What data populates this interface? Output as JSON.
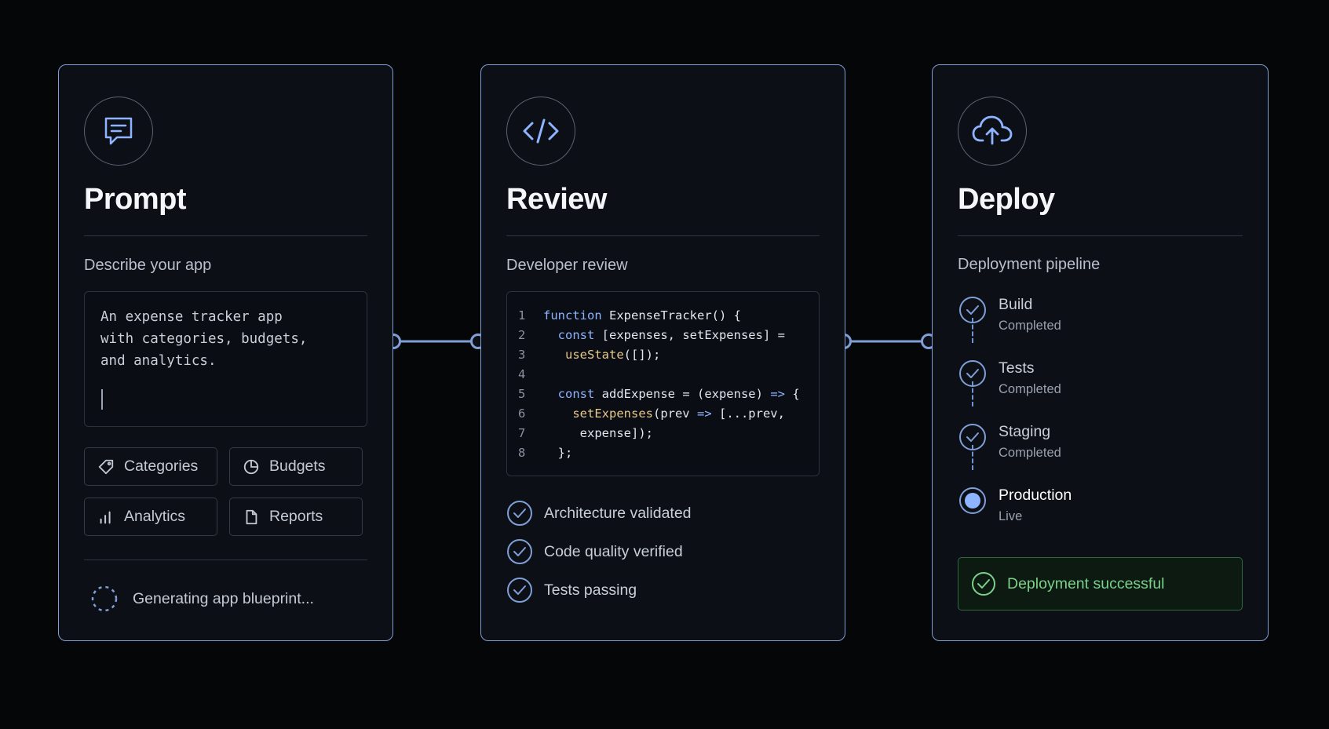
{
  "prompt_card": {
    "title": "Prompt",
    "icon": "chat-icon",
    "subhead": "Describe your app",
    "input_lines": [
      "An expense tracker app",
      "with categories, budgets,",
      "and analytics."
    ],
    "chips": [
      {
        "label": "Categories",
        "icon": "tag-icon"
      },
      {
        "label": "Budgets",
        "icon": "pie-chart-icon"
      },
      {
        "label": "Analytics",
        "icon": "bar-chart-icon"
      },
      {
        "label": "Reports",
        "icon": "document-icon"
      }
    ],
    "status": "Generating app blueprint..."
  },
  "review_card": {
    "title": "Review",
    "icon": "code-icon",
    "subhead": "Developer review",
    "code": [
      {
        "n": "1",
        "parts": [
          [
            "kw",
            "function "
          ],
          [
            "tx",
            "ExpenseTracker() {"
          ]
        ]
      },
      {
        "n": "2",
        "parts": [
          [
            "tx",
            "  "
          ],
          [
            "kw",
            "const "
          ],
          [
            "tx",
            "[expenses, setExpenses] ="
          ]
        ]
      },
      {
        "n": "3",
        "parts": [
          [
            "tx",
            "   "
          ],
          [
            "fn",
            "useState"
          ],
          [
            "tx",
            "([]);"
          ]
        ]
      },
      {
        "n": "4",
        "parts": []
      },
      {
        "n": "5",
        "parts": [
          [
            "tx",
            "  "
          ],
          [
            "kw",
            "const "
          ],
          [
            "tx",
            "addExpense = (expense) "
          ],
          [
            "kw",
            "=> "
          ],
          [
            "tx",
            "{"
          ]
        ]
      },
      {
        "n": "6",
        "parts": [
          [
            "tx",
            "    "
          ],
          [
            "fn",
            "setExpenses"
          ],
          [
            "tx",
            "(prev "
          ],
          [
            "kw",
            "=> "
          ],
          [
            "tx",
            "[...prev,"
          ]
        ]
      },
      {
        "n": "7",
        "parts": [
          [
            "tx",
            "     expense]);"
          ]
        ]
      },
      {
        "n": "8",
        "parts": [
          [
            "tx",
            "  };"
          ]
        ]
      }
    ],
    "checks": [
      "Architecture validated",
      "Code quality verified",
      "Tests passing"
    ]
  },
  "deploy_card": {
    "title": "Deploy",
    "icon": "cloud-upload-icon",
    "subhead": "Deployment pipeline",
    "steps": [
      {
        "name": "Build",
        "status": "Completed",
        "state": "done"
      },
      {
        "name": "Tests",
        "status": "Completed",
        "state": "done"
      },
      {
        "name": "Staging",
        "status": "Completed",
        "state": "done"
      },
      {
        "name": "Production",
        "status": "Live",
        "state": "active"
      }
    ],
    "success": "Deployment successful"
  },
  "colors": {
    "accent": "#7f9fd6",
    "success": "#7bd08a",
    "background": "#050608",
    "card": "#0c0f16"
  }
}
